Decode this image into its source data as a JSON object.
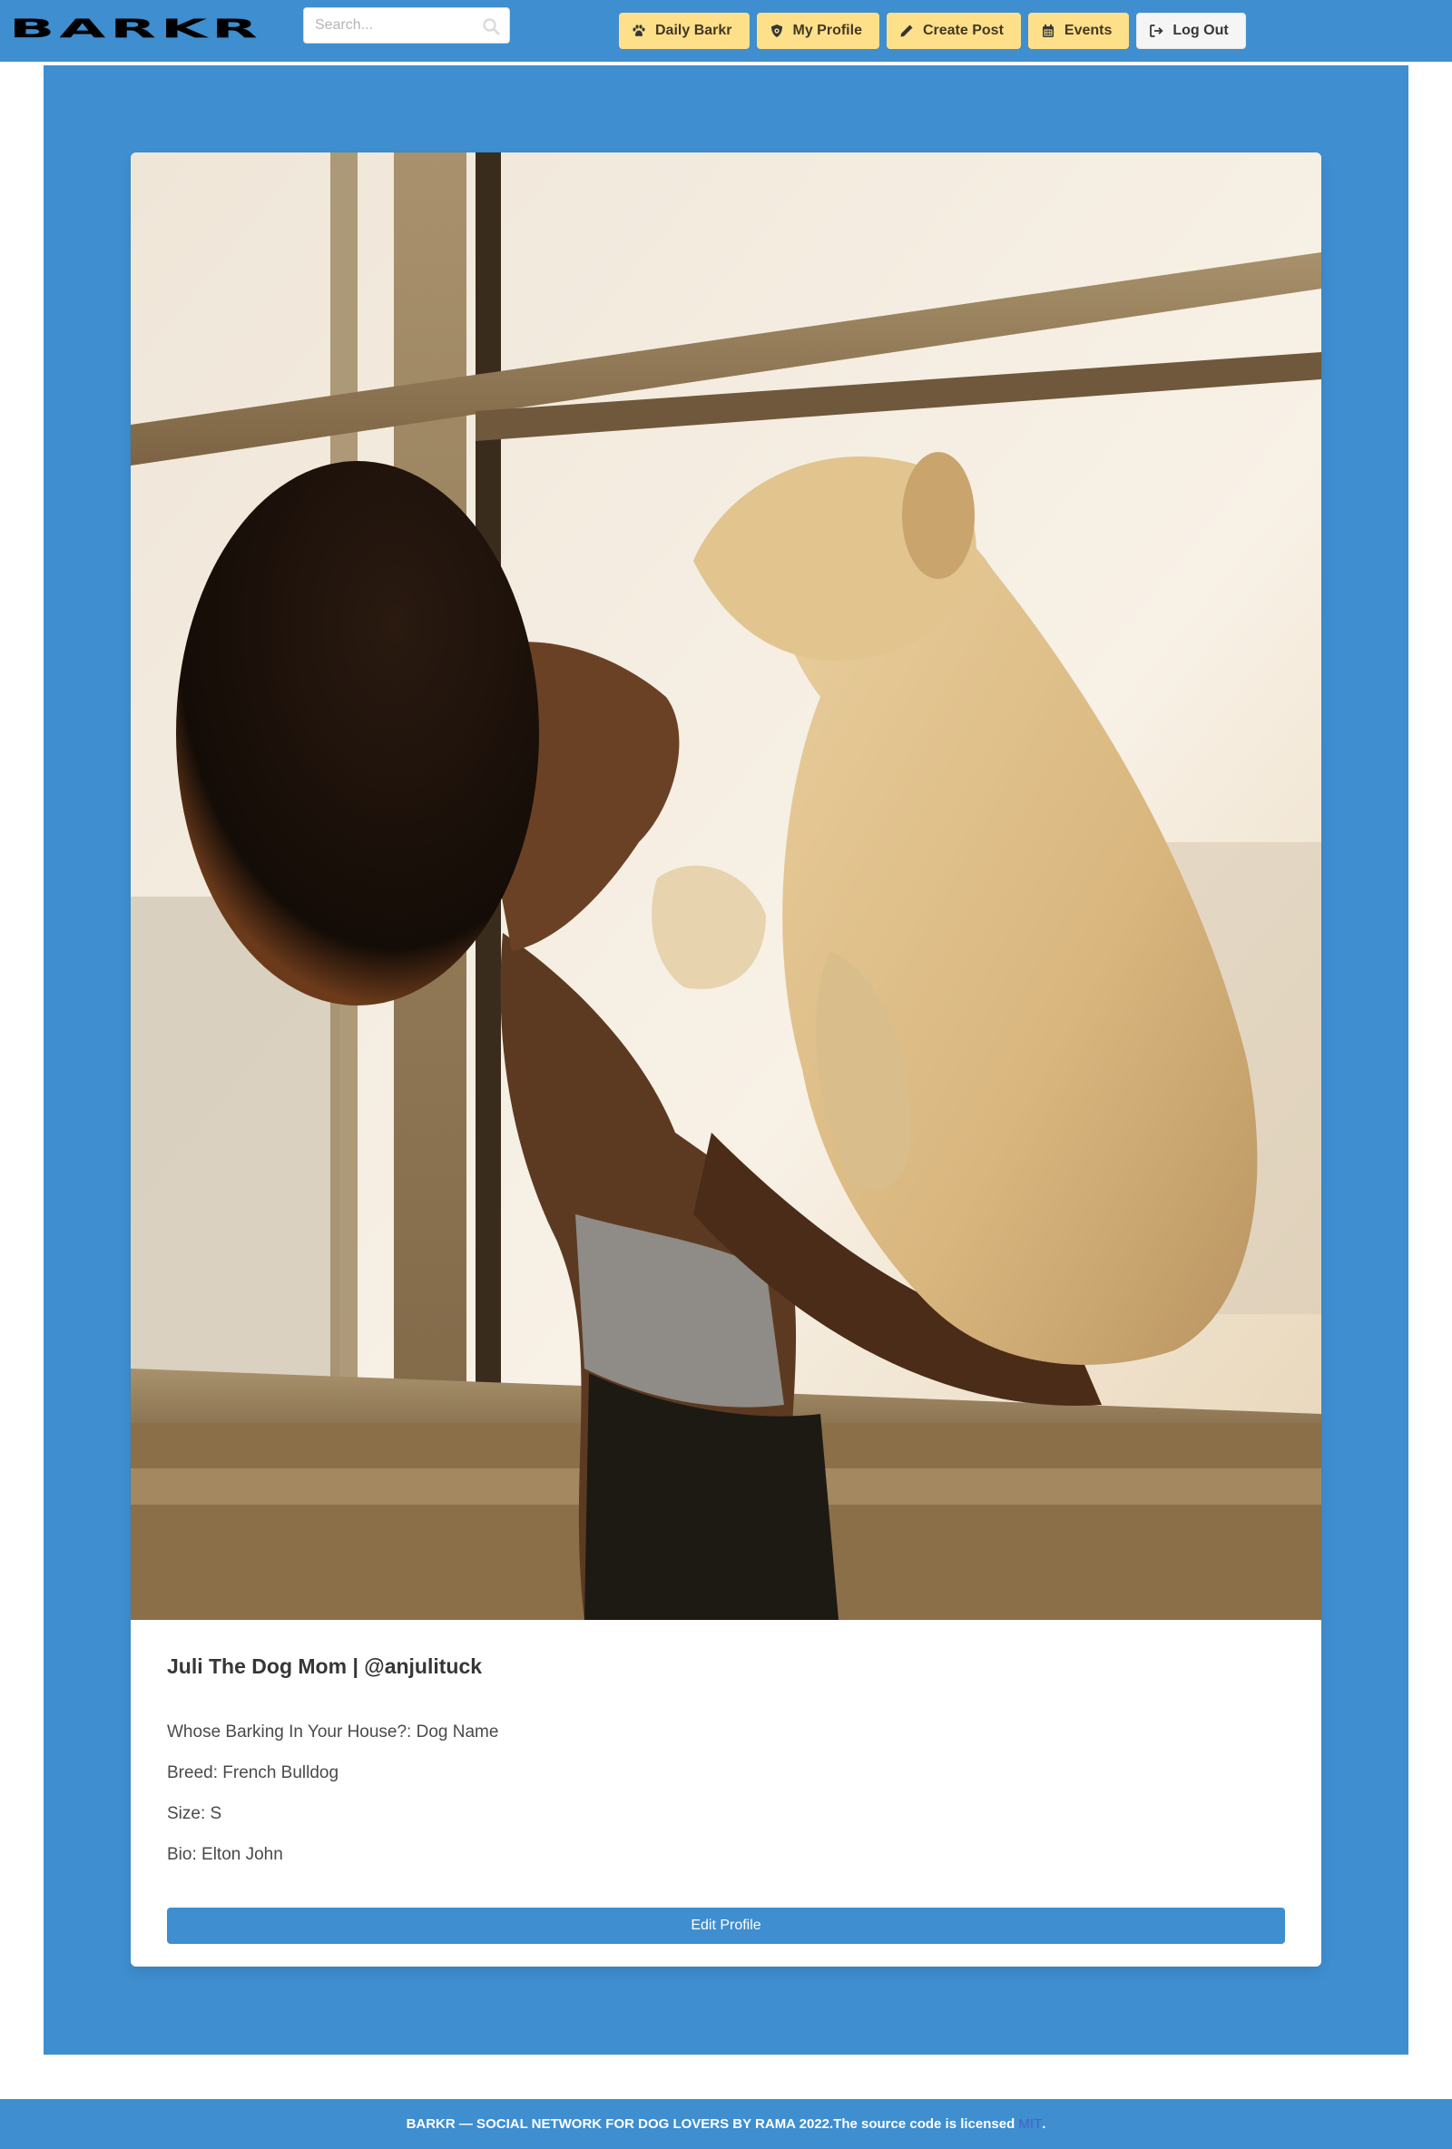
{
  "navbar": {
    "logo_text": "BARKR",
    "search": {
      "placeholder": "Search...",
      "value": ""
    },
    "buttons": [
      {
        "label": "Daily Barkr",
        "icon": "paw-icon",
        "color": "#ffe08a"
      },
      {
        "label": "My Profile",
        "icon": "shield-dog-icon",
        "color": "#ffe08a"
      },
      {
        "label": "Create Post",
        "icon": "pencil-icon",
        "color": "#ffe08a"
      },
      {
        "label": "Events",
        "icon": "calendar-icon",
        "color": "#ffe08a"
      },
      {
        "label": "Log Out",
        "icon": "sign-out-icon",
        "color": "#f5f5f5"
      }
    ]
  },
  "profile": {
    "title": "Juli The Dog Mom | @anjulituck",
    "fields": {
      "barking": "Whose Barking In Your House?: Dog Name",
      "breed": "Breed: French Bulldog",
      "size": "Size: S",
      "bio": "Bio: Elton John"
    },
    "edit_button_label": "Edit Profile"
  },
  "footer": {
    "text": "BARKR — SOCIAL NETWORK FOR DOG LOVERS BY RAMA 2022.The source code is licensed ",
    "link_text": "MIT",
    "suffix": "."
  },
  "colors": {
    "primary": "#3e8ed0",
    "warning": "#ffe08a",
    "light": "#f5f5f5",
    "link": "#485fc7"
  }
}
